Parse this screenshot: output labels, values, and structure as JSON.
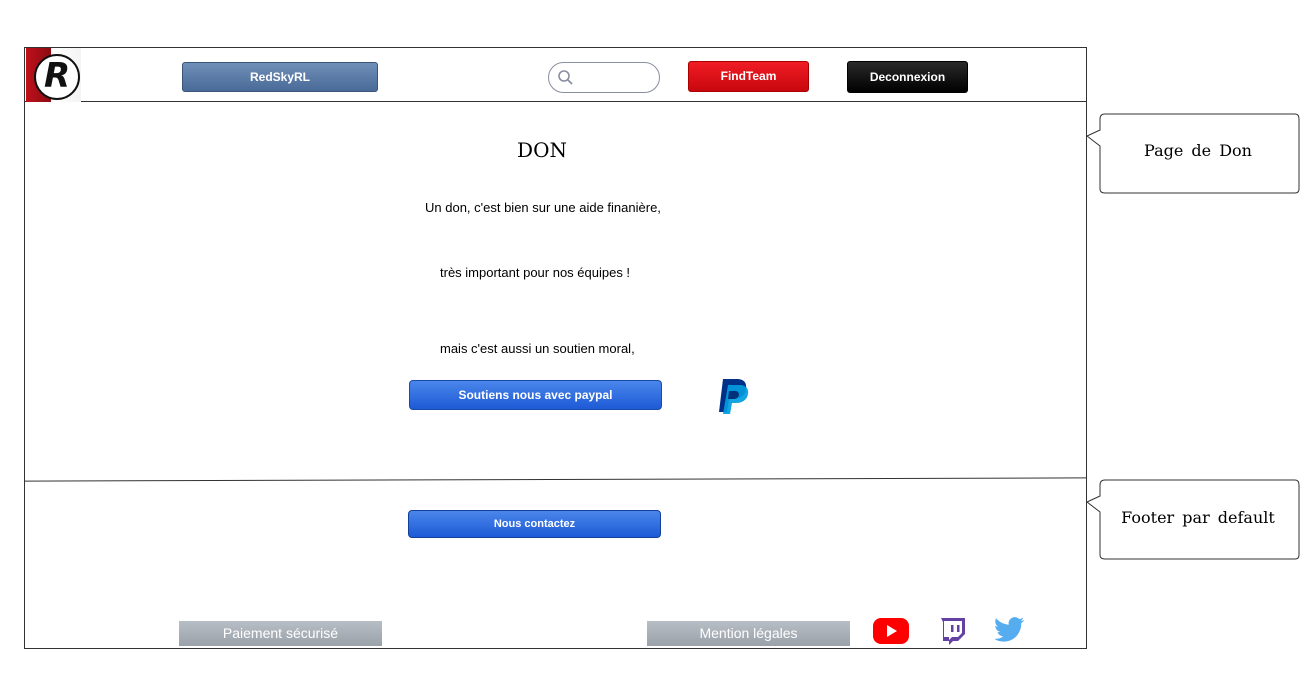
{
  "header": {
    "logo_alt": "RedSkyRL logo",
    "brand_button": "RedSkyRL",
    "search": {
      "value": "",
      "placeholder": ""
    },
    "findteam_button": "FindTeam",
    "logout_button": "Deconnexion"
  },
  "main": {
    "title": "DON",
    "lines": [
      "Un don, c'est bien sur une aide finanière,",
      "très important pour nos équipes !",
      "mais c'est aussi un soutien moral,"
    ],
    "paypal_button": "Soutiens nous avec paypal"
  },
  "footer": {
    "contact_button": "Nous contactez",
    "secure_payment": "Paiement sécurisé",
    "legal": "Mention légales",
    "social_icons": [
      "youtube-icon",
      "twitch-icon",
      "twitter-icon"
    ]
  },
  "annotations": {
    "page_label": "Page de Don",
    "footer_label": "Footer par default"
  },
  "colors": {
    "findteam": "#e3000b",
    "paypal_button": "#2a67dd",
    "brand_button": "#58779f",
    "youtube": "#ff0000",
    "twitch": "#6441a5",
    "twitter": "#55acee"
  }
}
